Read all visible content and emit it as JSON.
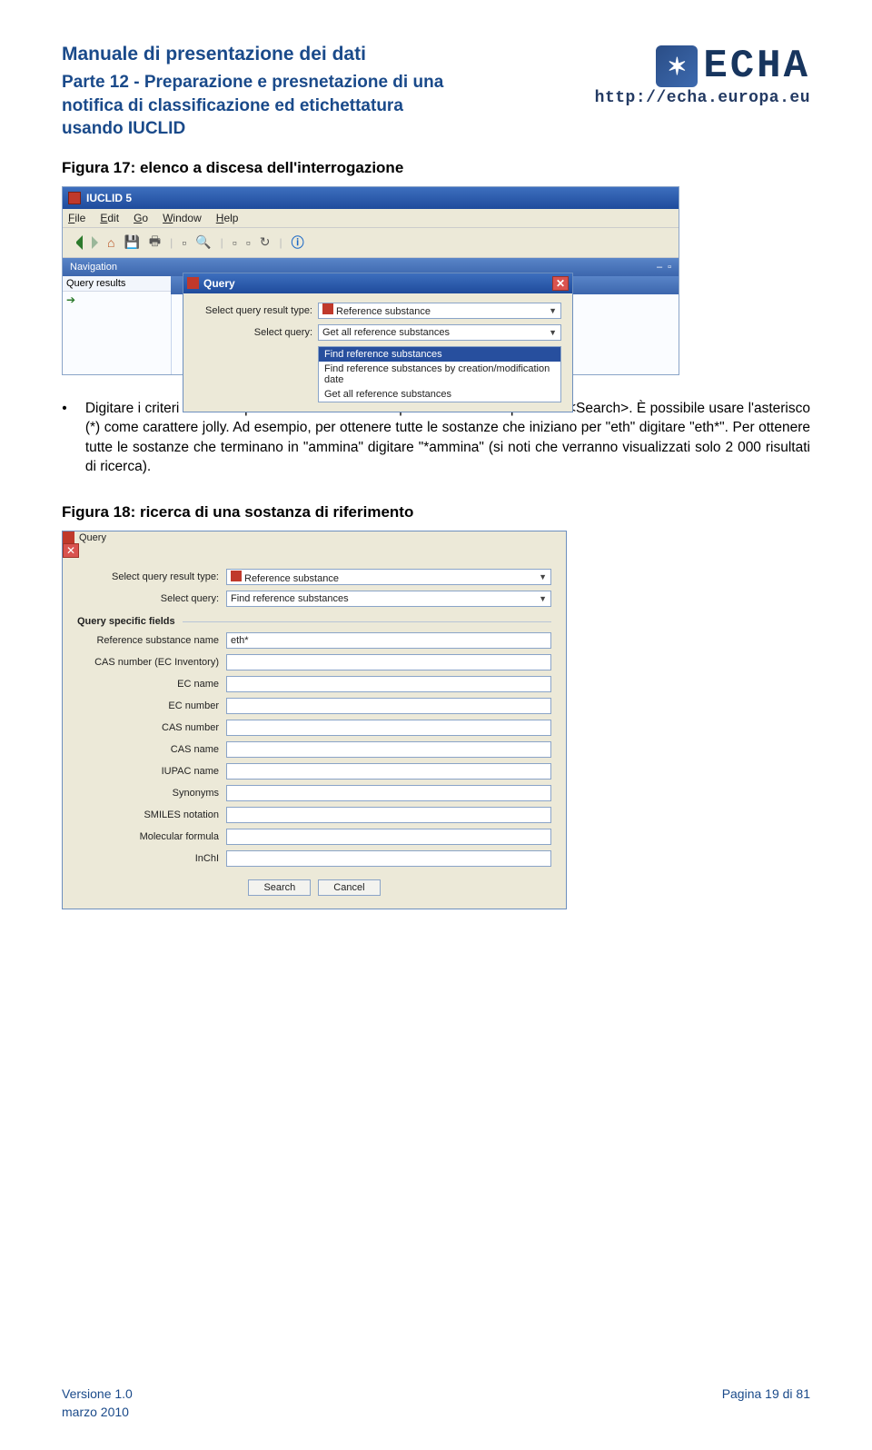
{
  "header": {
    "title_line1": "Manuale di presentazione dei dati",
    "title_line2": "Parte 12 - Preparazione e presnetazione di una notifica di classificazione ed etichettatura usando IUCLID",
    "logo_text": "ECHA",
    "logo_glyph": "✶",
    "url": "http://echa.europa.eu"
  },
  "fig17": {
    "caption": "Figura 17: elenco a discesa dell'interrogazione",
    "window_title": "IUCLID 5",
    "menu": {
      "file": "File",
      "edit": "Edit",
      "go": "Go",
      "window": "Window",
      "help": "Help"
    },
    "nav_label": "Navigation",
    "query_tab": "Query results",
    "dialog_title": "Query",
    "row1_label": "Select query result type:",
    "row1_value": "Reference substance",
    "row2_label": "Select query:",
    "row2_value": "Get all reference substances",
    "options": [
      "Find reference substances",
      "Find reference substances by creation/modification date",
      "Get all reference substances"
    ]
  },
  "body": {
    "text": "Digitare i criteri di ricerca per la sostanza cercata quindi fare clic sul pulsante <Search>. È possibile usare l'asterisco (*) come carattere jolly. Ad esempio, per ottenere tutte le sostanze che iniziano per \"eth\" digitare \"eth*\". Per ottenere tutte le sostanze che terminano in \"ammina\" digitare \"*ammina\" (si noti che verranno visualizzati solo 2 000 risultati di ricerca)."
  },
  "fig18": {
    "caption": "Figura 18: ricerca di una sostanza di riferimento",
    "dialog_title": "Query",
    "row1_label": "Select query result type:",
    "row1_value": "Reference substance",
    "row2_label": "Select query:",
    "row2_value": "Find reference substances",
    "fieldset_label": "Query specific fields",
    "fields": {
      "ref_name_label": "Reference substance name",
      "ref_name_value": "eth*",
      "cas_ec_label": "CAS number (EC Inventory)",
      "ec_name_label": "EC name",
      "ec_number_label": "EC number",
      "cas_number_label": "CAS number",
      "cas_name_label": "CAS name",
      "iupac_label": "IUPAC name",
      "synonyms_label": "Synonyms",
      "smiles_label": "SMILES notation",
      "molform_label": "Molecular formula",
      "inchi_label": "InChI"
    },
    "buttons": {
      "search": "Search",
      "cancel": "Cancel"
    }
  },
  "footer": {
    "version": "Versione 1.0",
    "date": "marzo 2010",
    "page": "Pagina 19 di 81"
  }
}
